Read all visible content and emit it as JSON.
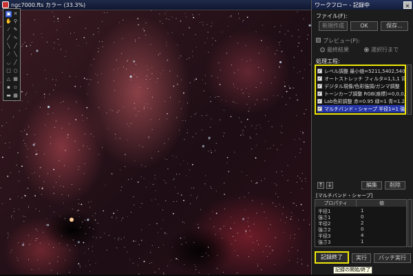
{
  "image_window": {
    "title": "ngc7000.fts カラー (33.3%)"
  },
  "tool_palette": {
    "tools": [
      "select-icon",
      "grab-icon",
      "zoom-icon",
      "eyedropper-icon",
      "pencil-icon",
      "line-icon",
      "rect-icon",
      "ellipse-icon",
      "brush-icon",
      "eraser-icon",
      "fill-icon",
      "text-icon"
    ]
  },
  "workflow": {
    "title": "ワークフロー - 記録中",
    "close_label": "×",
    "file_label": "ファイル(F):",
    "new_label": "新規作成",
    "ok_label": "OK",
    "save_label": "保存...",
    "preview_label": "プレビュー(P):",
    "preview_final": "最終結果",
    "preview_selected": "選択行まで",
    "steps_label": "処理工程:",
    "steps": [
      "レベル調整 最小値=5211,5402,5402",
      "オートストレッチ フィルタ=1,1,1 背景=2",
      "デジタル現像/色彩強調/ガンマ調整",
      "トーンカーブ調整 RGB(座標)=0,0,0,2",
      "Lab色彩調整 赤=0.95 緑=1 青=1.2",
      "マルチバンド・シャープ 半径1=1 強さ1"
    ],
    "up_label": "↑",
    "down_label": "↓",
    "edit_label": "編集",
    "delete_label": "削除",
    "props_title": "[マルチバンド・シャープ]",
    "props_headers": [
      "プロパティ",
      "値"
    ],
    "props_rows": [
      [
        "半径1",
        "1"
      ],
      [
        "強さ1",
        "0"
      ],
      [
        "半径2",
        "2"
      ],
      [
        "強さ2",
        "0"
      ],
      [
        "半径3",
        "4"
      ],
      [
        "強さ3",
        "1"
      ]
    ],
    "record_end_label": "記録終了",
    "run_label": "実行",
    "batch_label": "バッチ実行",
    "tooltip": "記録の開始/終了"
  }
}
